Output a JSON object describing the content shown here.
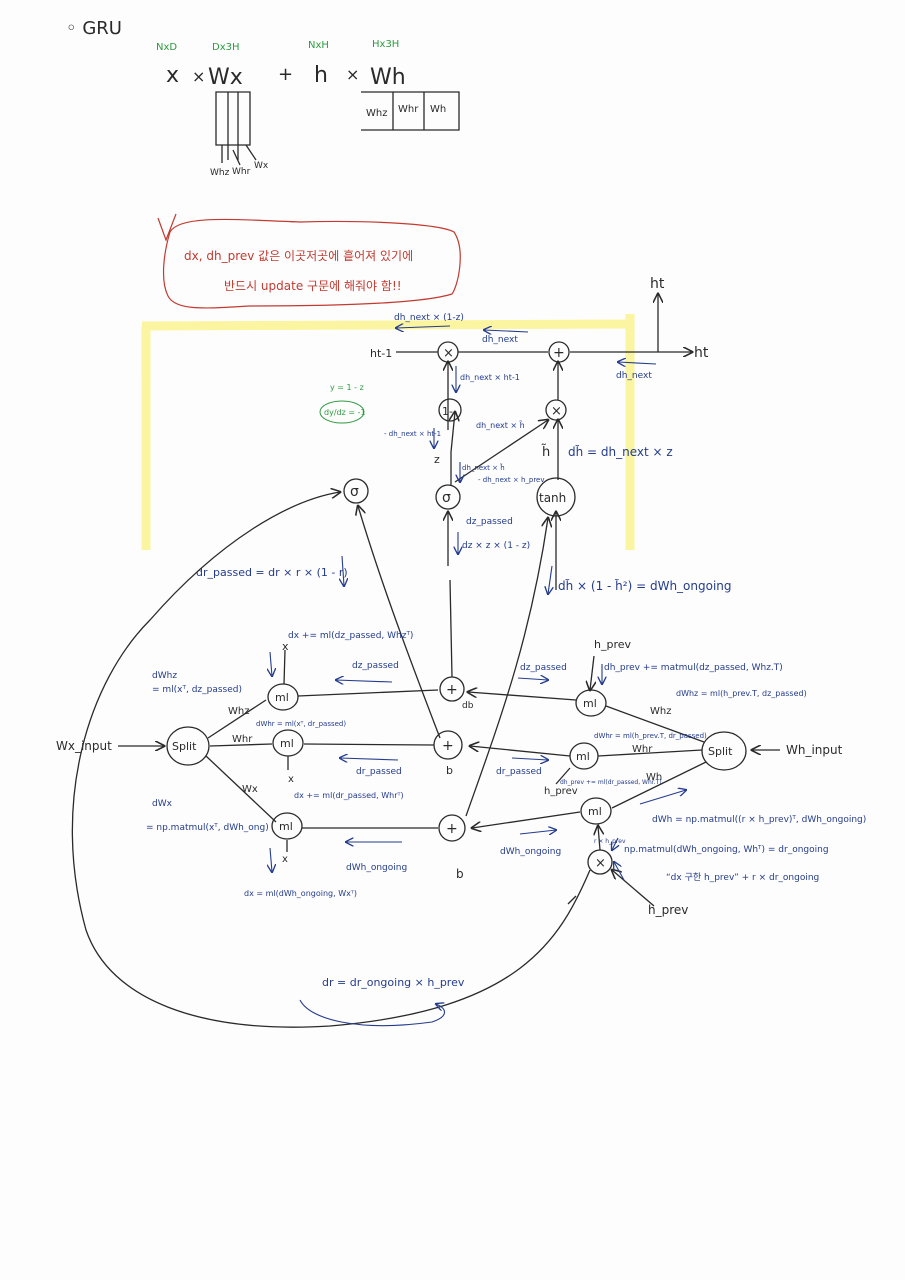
{
  "title": "◦ GRU",
  "colors": {
    "ink": "#2a2a2a",
    "blue": "#243c8c",
    "green": "#2e9a3e",
    "red": "#c23a30",
    "highlight": "#fbf497"
  },
  "header": {
    "dims": [
      "NxD",
      "Dx3H",
      "NxH",
      "Hx3H"
    ],
    "eq": {
      "x": "x",
      "times": "×",
      "wx": "Wx",
      "plus": "+",
      "h": "h",
      "wh": "Wh"
    },
    "wx_parts": [
      "Whz",
      "Whr",
      "Wx"
    ],
    "wh_parts": [
      "Whz",
      "Whr",
      "Wh"
    ]
  },
  "note": {
    "line1": "dx, dh_prev 값은 이곳저곳에 흩어져 있기에",
    "line2": "반드시 update 구문에 해줘야 함!!"
  },
  "top": {
    "ht": "ht",
    "ht_out": "ht",
    "h_t1": "ht-1",
    "dh_next_1z": "dh_next × (1-z)",
    "dh_next": "dh_next",
    "dh_next_right": "dh_next",
    "dh_next_hprev": "dh_next × ht-1",
    "dh_next_htilde": "dh_next × h̃",
    "minus_dh": "- dh_next × ht-1",
    "y_eq": "y = 1 - z",
    "dydz": "dy/dz = -1",
    "z": "z",
    "htilde": "h̃",
    "dhtilde": "dh̃ = dh_next × z",
    "dz_note1": "dh_next × h̃",
    "dz_note2": "- dh_next × h_prev",
    "dz_passed": "dz_passed",
    "dz_formula": "dz × z × (1 - z)",
    "dr_passed": "dr_passed = dr × r × (1 - r)",
    "dwh_ongoing": "dh̃ × (1 - h̃²) = dWh_ongoing"
  },
  "nodes": {
    "mul": "×",
    "plus": "+",
    "one_minus": "1-",
    "sigma": "σ",
    "tanh": "tanh",
    "mm": "ml",
    "split": "Split"
  },
  "left": {
    "wx_input": "Wx_input",
    "dWhz": "dWhz",
    "dWhz_eq": "= ml(xᵀ, dz_passed)",
    "dx_z": "dx += ml(dz_passed, Whzᵀ)",
    "x": "x",
    "whz": "Whz",
    "whr": "Whr",
    "wx": "Wx",
    "dWhr": "dWhr = ml(xᵀ, dr_passed)",
    "dx_r": "dx += ml(dr_passed, Whrᵀ)",
    "dz_passed": "dz_passed",
    "dr_passed": "dr_passed",
    "dWx": "dWx",
    "dWx_eq": "= np.matmul(xᵀ, dWh_ong)",
    "dwh_ongoing": "dWh_ongoing",
    "dx_h": "dx = ml(dWh_ongoing, Wxᵀ)",
    "b": "b",
    "db": "db"
  },
  "right": {
    "h_prev_top": "h_prev",
    "dh_prev_eq": "dh_prev += matmul(dz_passed, Whz.T)",
    "dWhz_eq": "dWhz = ml(h_prev.T, dz_passed)",
    "whz": "Whz",
    "whr": "Whr",
    "wh": "Wh",
    "split": "Split",
    "wh_input": "Wh_input",
    "dWhr_eq": "dWhr = ml(h_prev.T, dr_passed)",
    "dh_prev_r": "dh_prev += ml(dr_passed, Whr.T)",
    "h_prev_mid": "h_prev",
    "dz_passed": "dz_passed",
    "dr_passed": "dr_passed",
    "dWh_eq": "dWh = np.matmul((r × h_prev)ᵀ, dWh_ongoing)",
    "matmul_eq": "np.matmul(dWh_ongoing, Whᵀ) = dr_ongoing",
    "r_hprev": "r × h_prev",
    "dx_note": "“dx 구한 h_prev” + r × dr_ongoing",
    "hprev_bottom": "h_prev",
    "dWh_ongoing": "dWh_ongoing"
  },
  "bottom": {
    "dr_eq": "dr = dr_ongoing × h_prev"
  }
}
